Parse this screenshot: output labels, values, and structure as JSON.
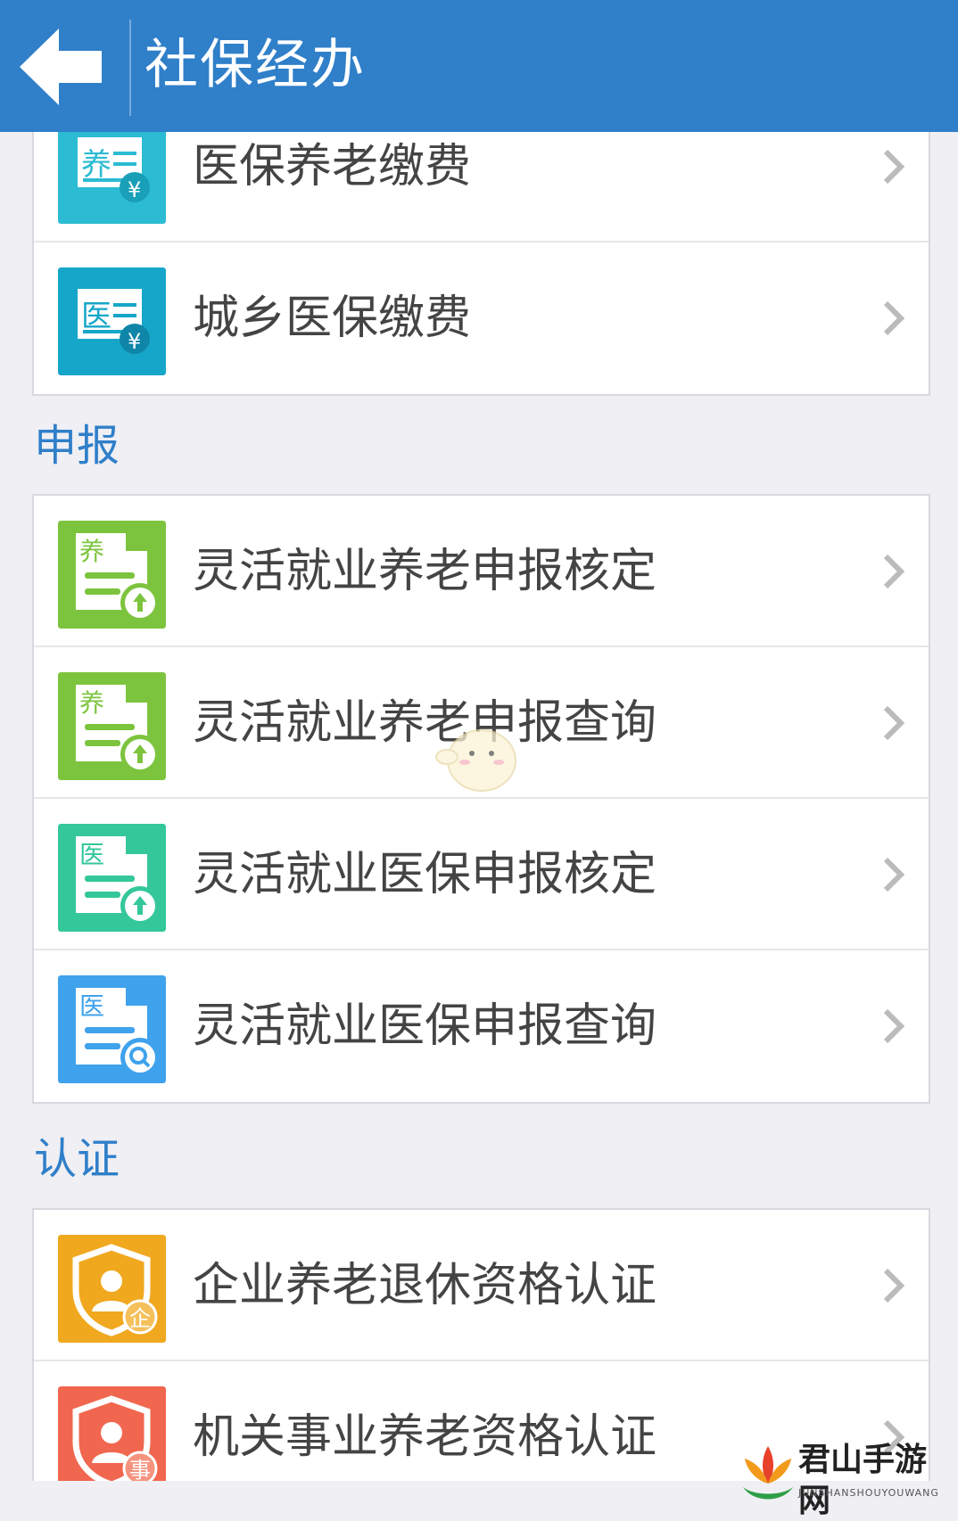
{
  "header": {
    "title": "社保经办"
  },
  "payment": {
    "items": [
      {
        "label": "医保养老缴费",
        "icon": "pension-payment-icon",
        "icon_char": "养",
        "color": "#2bbbd3"
      },
      {
        "label": "城乡医保缴费",
        "icon": "medical-payment-icon",
        "icon_char": "医",
        "color": "#16a6c9"
      }
    ]
  },
  "declare": {
    "section_title": "申报",
    "items": [
      {
        "label": "灵活就业养老申报核定",
        "icon": "pension-upload-icon",
        "icon_char": "养",
        "color": "#7dc43e"
      },
      {
        "label": "灵活就业养老申报查询",
        "icon": "pension-upload-icon",
        "icon_char": "养",
        "color": "#7dc43e"
      },
      {
        "label": "灵活就业医保申报核定",
        "icon": "medical-upload-icon",
        "icon_char": "医",
        "color": "#34c79a"
      },
      {
        "label": "灵活就业医保申报查询",
        "icon": "medical-search-icon",
        "icon_char": "医",
        "color": "#3fa2ec"
      }
    ]
  },
  "certify": {
    "section_title": "认证",
    "items": [
      {
        "label": "企业养老退休资格认证",
        "icon": "enterprise-shield-icon",
        "icon_char": "企",
        "color": "#f0a81f"
      },
      {
        "label": "机关事业养老资格认证",
        "icon": "institution-shield-icon",
        "icon_char": "事",
        "color": "#f1664f"
      }
    ]
  },
  "watermark": {
    "name": "君山手游网",
    "sub": "JUNSHANSHOUYOUWANG"
  }
}
